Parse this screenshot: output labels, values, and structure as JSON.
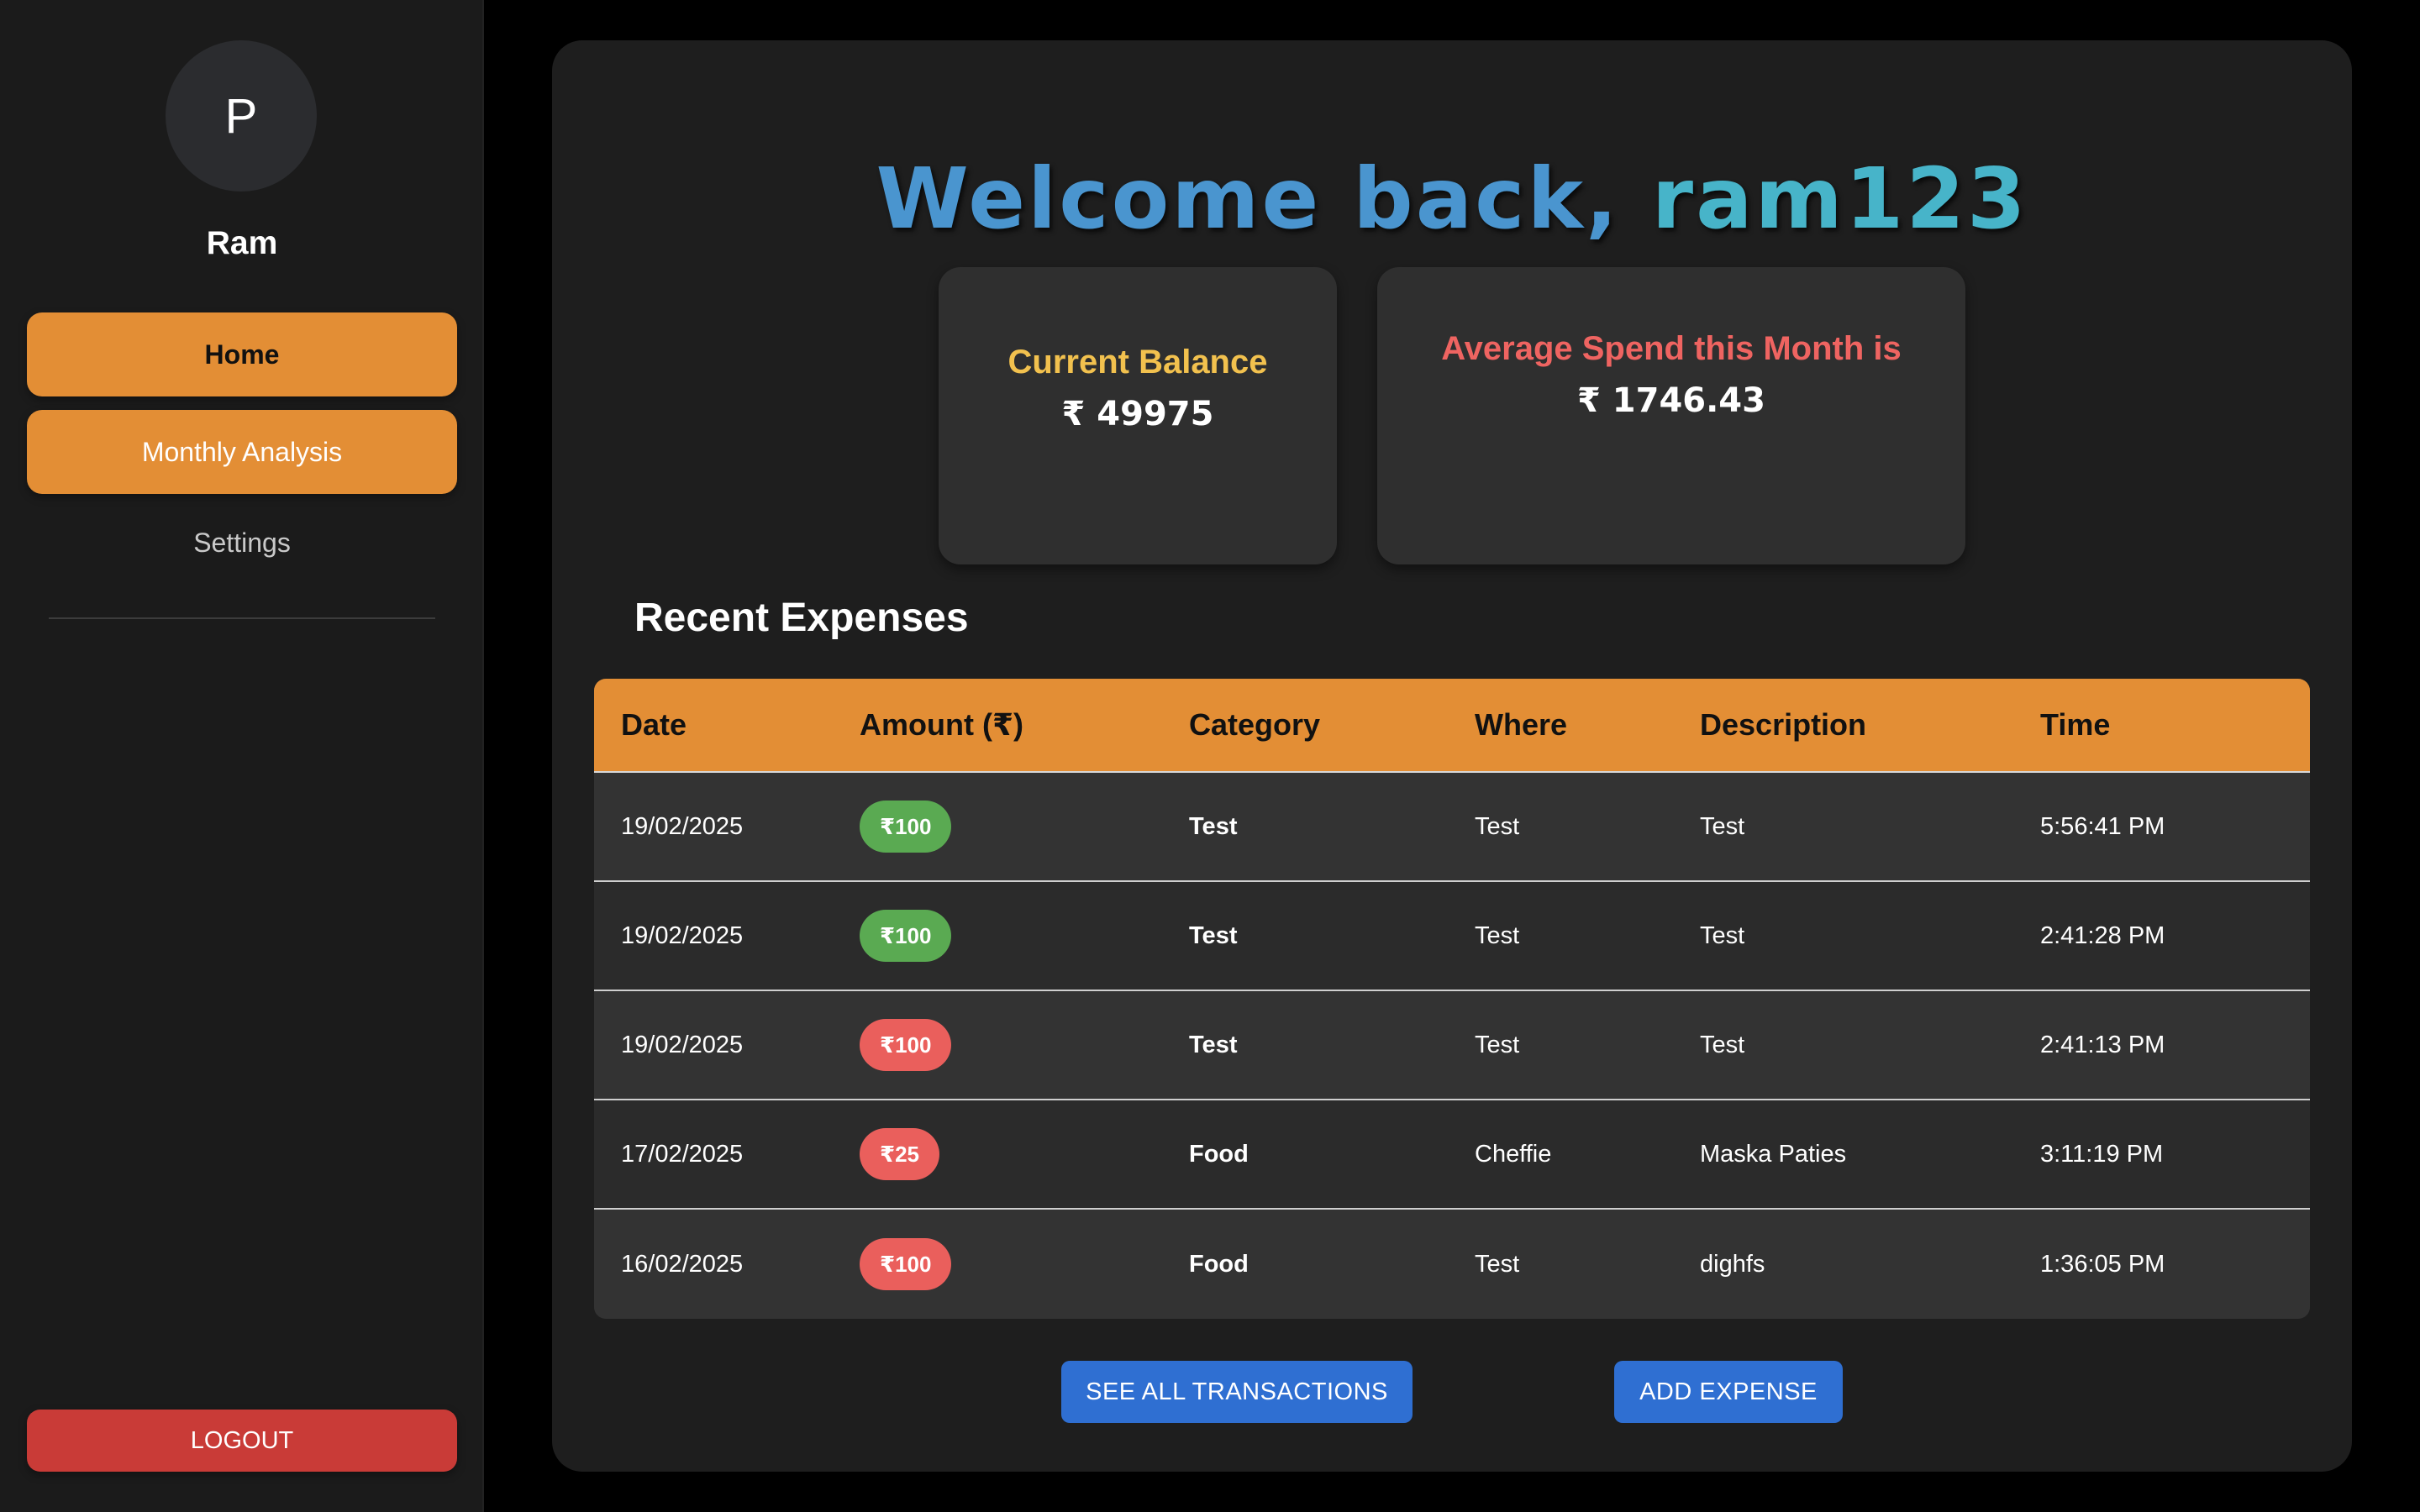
{
  "sidebar": {
    "avatar_initial": "P",
    "user_name": "Ram",
    "nav": {
      "home": "Home",
      "monthly_analysis": "Monthly Analysis",
      "settings": "Settings"
    },
    "logout": "LOGOUT"
  },
  "main": {
    "welcome_prefix": "Welcome back, ",
    "welcome_user": "ram123",
    "balance_card": {
      "title": "Current Balance",
      "value": "₹ 49975"
    },
    "avg_card": {
      "title": "Average Spend this Month is",
      "value": "₹ 1746.43"
    },
    "section_title": "Recent Expenses",
    "table": {
      "headers": [
        "Date",
        "Amount (₹)",
        "Category",
        "Where",
        "Description",
        "Time"
      ],
      "rows": [
        {
          "date": "19/02/2025",
          "amount": "₹100",
          "amount_color": "green",
          "category": "Test",
          "where": "Test",
          "description": "Test",
          "time": "5:56:41 PM"
        },
        {
          "date": "19/02/2025",
          "amount": "₹100",
          "amount_color": "green",
          "category": "Test",
          "where": "Test",
          "description": "Test",
          "time": "2:41:28 PM"
        },
        {
          "date": "19/02/2025",
          "amount": "₹100",
          "amount_color": "red",
          "category": "Test",
          "where": "Test",
          "description": "Test",
          "time": "2:41:13 PM"
        },
        {
          "date": "17/02/2025",
          "amount": "₹25",
          "amount_color": "red",
          "category": "Food",
          "where": "Cheffie",
          "description": "Maska Paties",
          "time": "3:11:19 PM"
        },
        {
          "date": "16/02/2025",
          "amount": "₹100",
          "amount_color": "red",
          "category": "Food",
          "where": "Test",
          "description": "dighfs",
          "time": "1:36:05 PM"
        }
      ]
    },
    "buttons": {
      "see_all": "SEE ALL TRANSACTIONS",
      "add_expense": "ADD EXPENSE"
    }
  },
  "colors": {
    "accent_orange": "#e38e35",
    "button_blue": "#2f6fd2",
    "logout_red": "#c93b37",
    "income_green": "#5aaa52",
    "expense_red": "#ea5f5c",
    "balance_yellow": "#f2c14e"
  }
}
